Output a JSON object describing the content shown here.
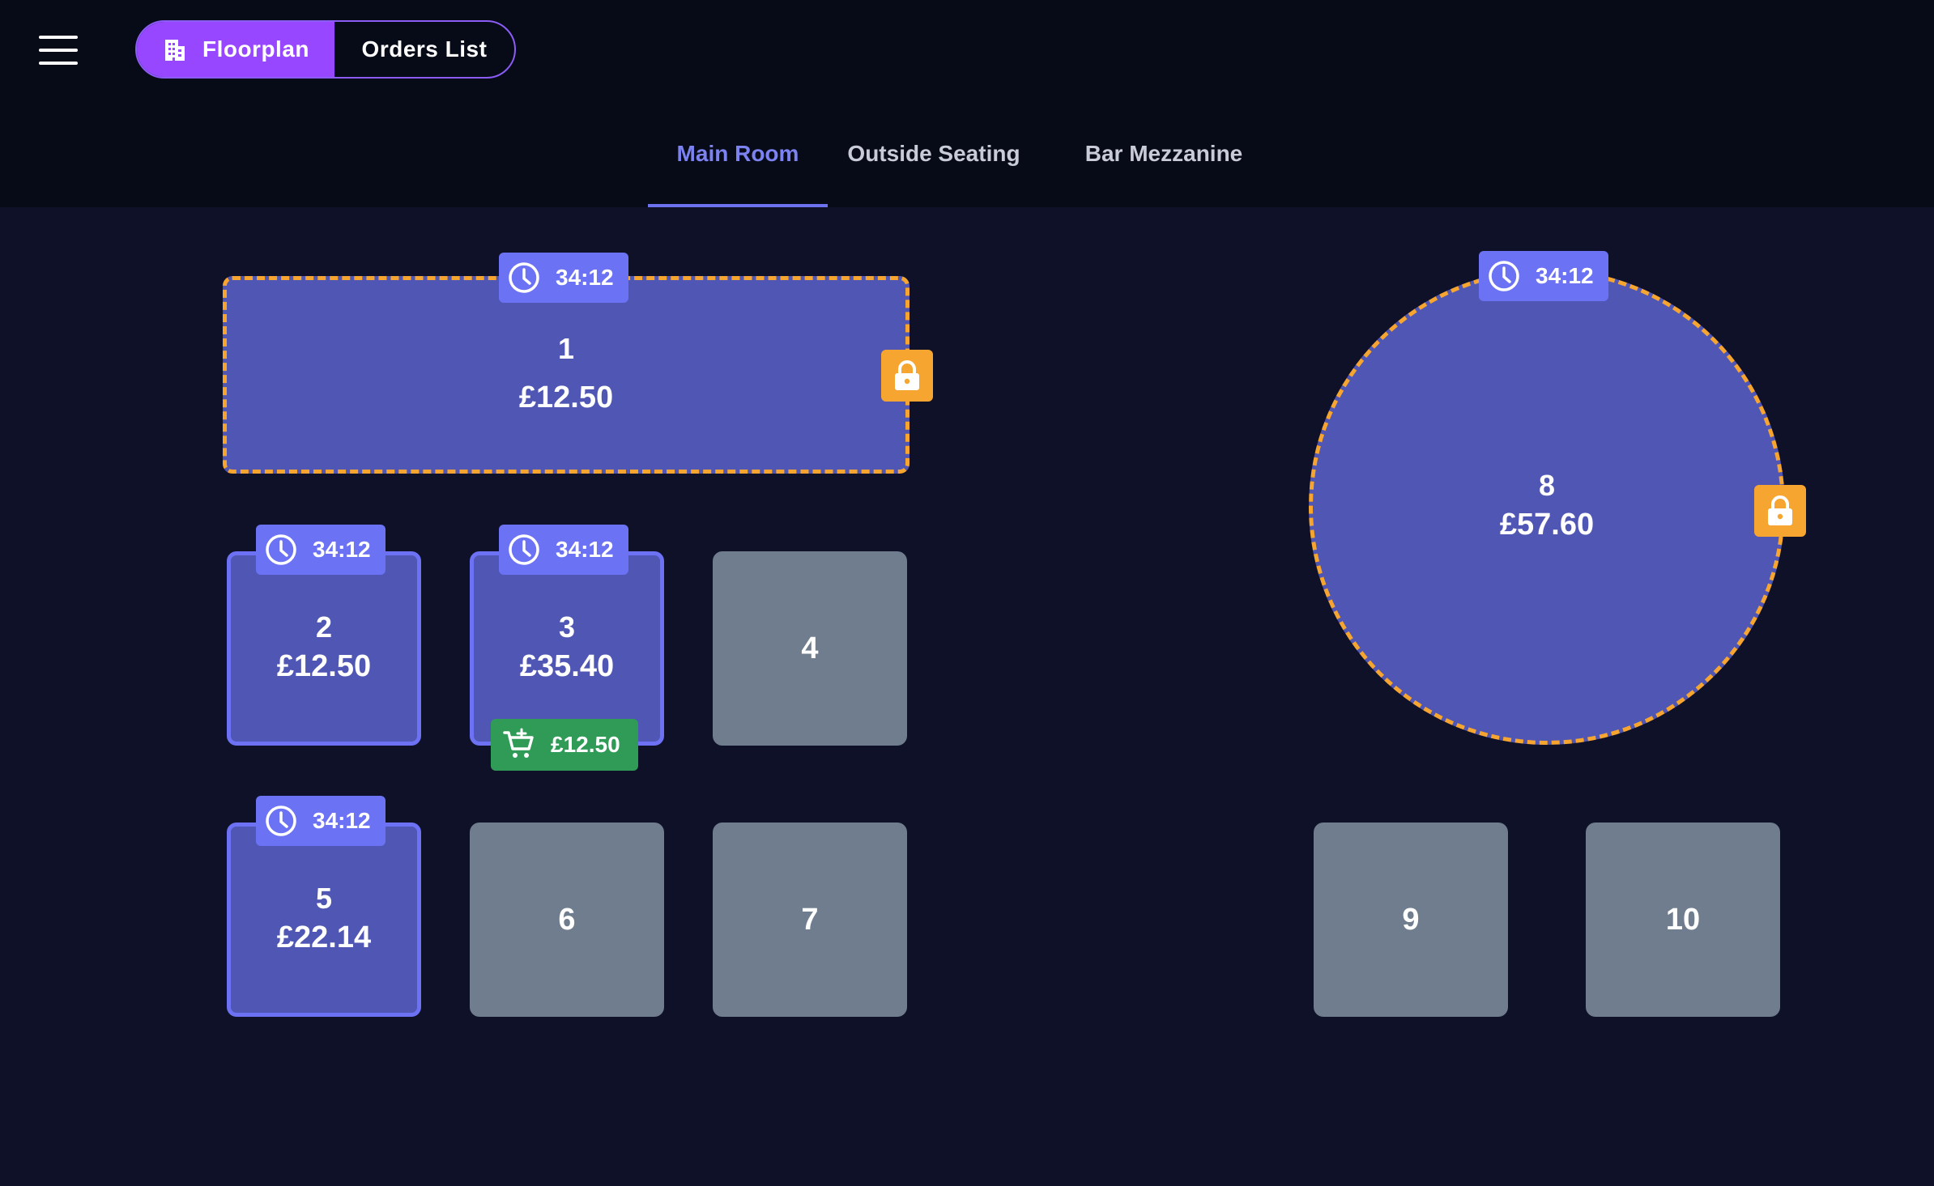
{
  "header": {
    "segment": {
      "floorplan_label": "Floorplan",
      "orders_label": "Orders List"
    },
    "tabs": [
      {
        "label": "Main Room",
        "active": true
      },
      {
        "label": "Outside Seating",
        "active": false
      },
      {
        "label": "Bar Mezzanine",
        "active": false
      }
    ]
  },
  "tables": {
    "t1": {
      "number": "1",
      "amount": "£12.50",
      "timer": "34:12",
      "status": "locked"
    },
    "t2": {
      "number": "2",
      "amount": "£12.50",
      "timer": "34:12",
      "status": "occupied"
    },
    "t3": {
      "number": "3",
      "amount": "£35.40",
      "timer": "34:12",
      "status": "occupied",
      "cart_amount": "£12.50"
    },
    "t4": {
      "number": "4",
      "status": "empty"
    },
    "t5": {
      "number": "5",
      "amount": "£22.14",
      "timer": "34:12",
      "status": "occupied"
    },
    "t6": {
      "number": "6",
      "status": "empty"
    },
    "t7": {
      "number": "7",
      "status": "empty"
    },
    "t8": {
      "number": "8",
      "amount": "£57.60",
      "timer": "34:12",
      "status": "locked"
    },
    "t9": {
      "number": "9",
      "status": "empty"
    },
    "t10": {
      "number": "10",
      "status": "empty"
    }
  },
  "icons": {
    "menu": "hamburger-menu-icon",
    "floorplan": "building-icon",
    "timer": "clock-icon",
    "lock": "lock-icon",
    "cart": "cart-add-icon"
  },
  "colors": {
    "background": "#0f1129",
    "header": "#070a17",
    "accent_purple": "#9747ff",
    "occupied": "#4f56b3",
    "occupied_border": "#6d72f5",
    "empty": "#6f7d8e",
    "lock": "#f7a531",
    "cart": "#2f9b57",
    "active_tab": "#7c83f0"
  }
}
